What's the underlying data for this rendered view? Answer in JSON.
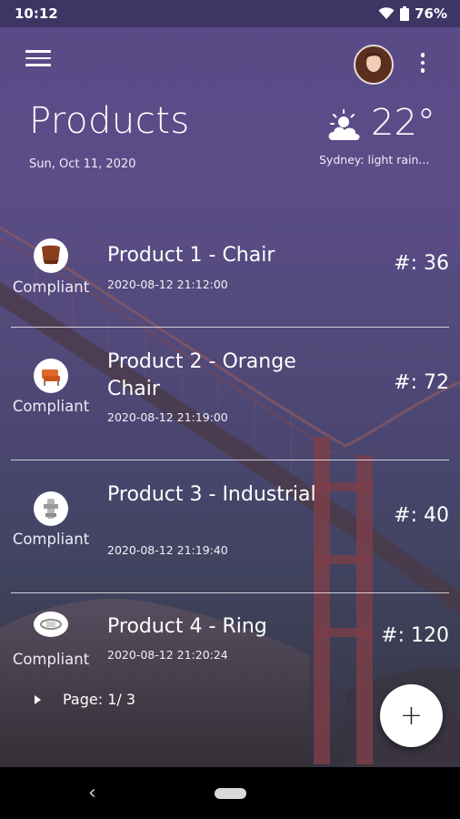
{
  "statusbar": {
    "time": "10:12",
    "battery": "76%"
  },
  "header": {
    "title": "Products",
    "date": "Sun, Oct 11, 2020"
  },
  "weather": {
    "temperature": "22°",
    "description": "Sydney: light rain..."
  },
  "products": [
    {
      "name": "Product 1 - Chair",
      "timestamp": "2020-08-12 21:12:00",
      "count": "#: 36",
      "status": "Compliant",
      "icon": "chair-icon"
    },
    {
      "name": "Product 2 - Orange Chair",
      "timestamp": "2020-08-12 21:19:00",
      "count": "#: 72",
      "status": "Compliant",
      "icon": "orange-chair-icon"
    },
    {
      "name": "Product 3 - Industrial",
      "timestamp": "2020-08-12 21:19:40",
      "count": "#: 40",
      "status": "Compliant",
      "icon": "industrial-icon"
    },
    {
      "name": "Product 4 - Ring",
      "timestamp": "2020-08-12 21:20:24",
      "count": "#: 120",
      "status": "Compliant",
      "icon": "ring-icon"
    }
  ],
  "pager": {
    "label": "Page: 1/ 3"
  },
  "fab": {
    "label": "+"
  },
  "navbar": {
    "back": "‹"
  },
  "colors": {
    "header_purple": "#5a4a87",
    "statusbar": "#3d3564",
    "fab": "#ffffff"
  }
}
